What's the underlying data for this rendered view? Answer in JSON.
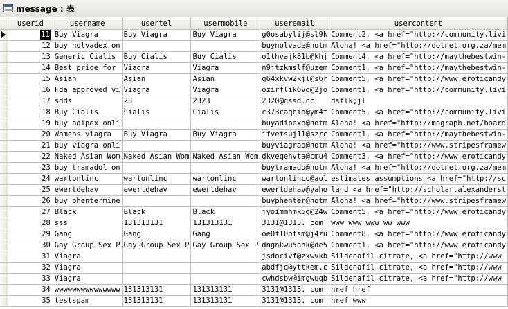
{
  "window": {
    "title": "message : 表"
  },
  "grid": {
    "columns": [
      "userid",
      "username",
      "usertel",
      "usermobile",
      "useremail",
      "usercontent"
    ],
    "rows": [
      {
        "userid": "11",
        "username": "Buy Viagra",
        "usertel": "Buy Viagra",
        "usermobile": "Buy Viagra",
        "useremail": "g0osabylij@sl9k",
        "usercontent": "Comment2, <a href=\"http://community.livi"
      },
      {
        "userid": "12",
        "username": "buy nolvadex on",
        "usertel": "",
        "usermobile": "",
        "useremail": "buynolvade@hotm",
        "usercontent": "Aloha! <a href=\"http://dotnet.org.za/mem"
      },
      {
        "userid": "13",
        "username": "Generic Cialis",
        "usertel": "Buy Cialis",
        "usermobile": "Buy Cialis",
        "useremail": "o1thvajk81b@khj",
        "usercontent": "Comment4, <a href=\"http://maythebestwin-"
      },
      {
        "userid": "14",
        "username": "Best price for",
        "usertel": "Viagra",
        "usermobile": "Viagra",
        "useremail": "n9jtzkmslf@uzem",
        "usercontent": "Comment1, <a href=\"http://maythebestwin-"
      },
      {
        "userid": "15",
        "username": "Asian",
        "usertel": "Asian",
        "usermobile": "Asian",
        "useremail": "g64xkvw2kjl@s6r",
        "usercontent": "Comment5, <a href=\"http://www.eroticandy"
      },
      {
        "userid": "16",
        "username": "Fda approved vi",
        "usertel": "Viagra",
        "usermobile": "Viagra",
        "useremail": "ozirflik6vq@2jo",
        "usercontent": "Comment1, <a href=\"http://community.livi"
      },
      {
        "userid": "17",
        "username": "sdds",
        "usertel": "23",
        "usermobile": "2323",
        "useremail": "2320@dssd.cc",
        "usercontent": "dsflk;jl"
      },
      {
        "userid": "18",
        "username": "Buy Cialis",
        "usertel": "Cialis",
        "usermobile": "Cialis",
        "useremail": "c373caqbio@ym4t",
        "usercontent": "Comment5, <a href=\"http://community.livi"
      },
      {
        "userid": "19",
        "username": "buy adipex onli",
        "usertel": "",
        "usermobile": "",
        "useremail": "buyadipexo@hotm",
        "usercontent": "Aloha! <a href=\"http://mograph.net/board"
      },
      {
        "userid": "20",
        "username": "Womens viagra",
        "usertel": "Buy Viagra",
        "usermobile": "Buy Viagra",
        "useremail": "ifvetsuj11@szrc",
        "usercontent": "Comment1, <a href=\"http://maythebestwin-"
      },
      {
        "userid": "21",
        "username": "buy viagra onli",
        "usertel": "",
        "usermobile": "",
        "useremail": "buyviagrao@hotm",
        "usercontent": "Aloha! <a href=\"http://www.stripesframew"
      },
      {
        "userid": "22",
        "username": "Naked Asian Wom",
        "usertel": "Naked Asian Wom",
        "usermobile": "Naked Asian Wom",
        "useremail": "dkveqehvta@cmu4",
        "usercontent": "Comment3, <a href=\"http://www.eroticandy"
      },
      {
        "userid": "23",
        "username": "buy tramadol on",
        "usertel": "",
        "usermobile": "",
        "useremail": "buytramado@hotm",
        "usercontent": "Aloha! <a href=\"http://dotnet.org.za/mem"
      },
      {
        "userid": "24",
        "username": "wartonlinc",
        "usertel": "wartonlinc",
        "usermobile": "wartonlinc",
        "useremail": "wartonlinco@aol",
        "usercontent": "estimates assumptions <a href=\"http://sc"
      },
      {
        "userid": "25",
        "username": "ewertdehav",
        "usertel": "ewertdehav",
        "usermobile": "ewertdehav",
        "useremail": "ewertdehav@yaho",
        "usercontent": "land <a href=\"http://scholar.alexanderst"
      },
      {
        "userid": "26",
        "username": "buy phentermine",
        "usertel": "",
        "usermobile": "",
        "useremail": "buyphenter@hotm",
        "usercontent": "Aloha! <a href=\"http://www.stripesframew"
      },
      {
        "userid": "27",
        "username": "Black",
        "usertel": "Black",
        "usermobile": "Black",
        "useremail": "jyoimmhmk5g@24w",
        "usercontent": "Comment5, <a href=\"http://www.eroticandy"
      },
      {
        "userid": "28",
        "username": "sss",
        "usertel": "131313131",
        "usermobile": "131313131",
        "useremail": "3131@1313. com",
        "usercontent": "www www www ww www"
      },
      {
        "userid": "29",
        "username": "Gang",
        "usertel": "Gang",
        "usermobile": "Gang",
        "useremail": "oe0fl0ofsm@j4zu",
        "usercontent": "Comment8, <a href=\"http://www.eroticandy"
      },
      {
        "userid": "30",
        "username": "Gay Group Sex P",
        "usertel": "Gay Group Sex P",
        "usermobile": "Gay Group Sex P",
        "useremail": "dngnkwu5onk@de5",
        "usercontent": "Comment1, <a href=\"http://www.eroticandy"
      },
      {
        "userid": "31",
        "username": "Viagra",
        "usertel": "",
        "usermobile": "",
        "useremail": "jsdocivf@zxwvkb",
        "usercontent": " Sildenafil citrate, <a href=\"http://www"
      },
      {
        "userid": "32",
        "username": "Viagra",
        "usertel": "",
        "usermobile": "",
        "useremail": "abdfjq@yttkem.c",
        "usercontent": " Sildenafil citrate, <a href=\"http://www"
      },
      {
        "userid": "33",
        "username": "Viagra",
        "usertel": "",
        "usermobile": "",
        "useremail": "cwhdsbw@imgwuqb",
        "usercontent": " Sildenafil citrate, <a href=\"http://www"
      },
      {
        "userid": "34",
        "username": "wwwwwwwwwwwwwww",
        "usertel": "131313131",
        "usermobile": "131313131",
        "useremail": "3131@1313. com",
        "usercontent": " href href"
      },
      {
        "userid": "35",
        "username": "testspam",
        "usertel": "131313131",
        "usermobile": "131313131",
        "useremail": "3131@1313. com",
        "usercontent": "href www"
      }
    ]
  }
}
